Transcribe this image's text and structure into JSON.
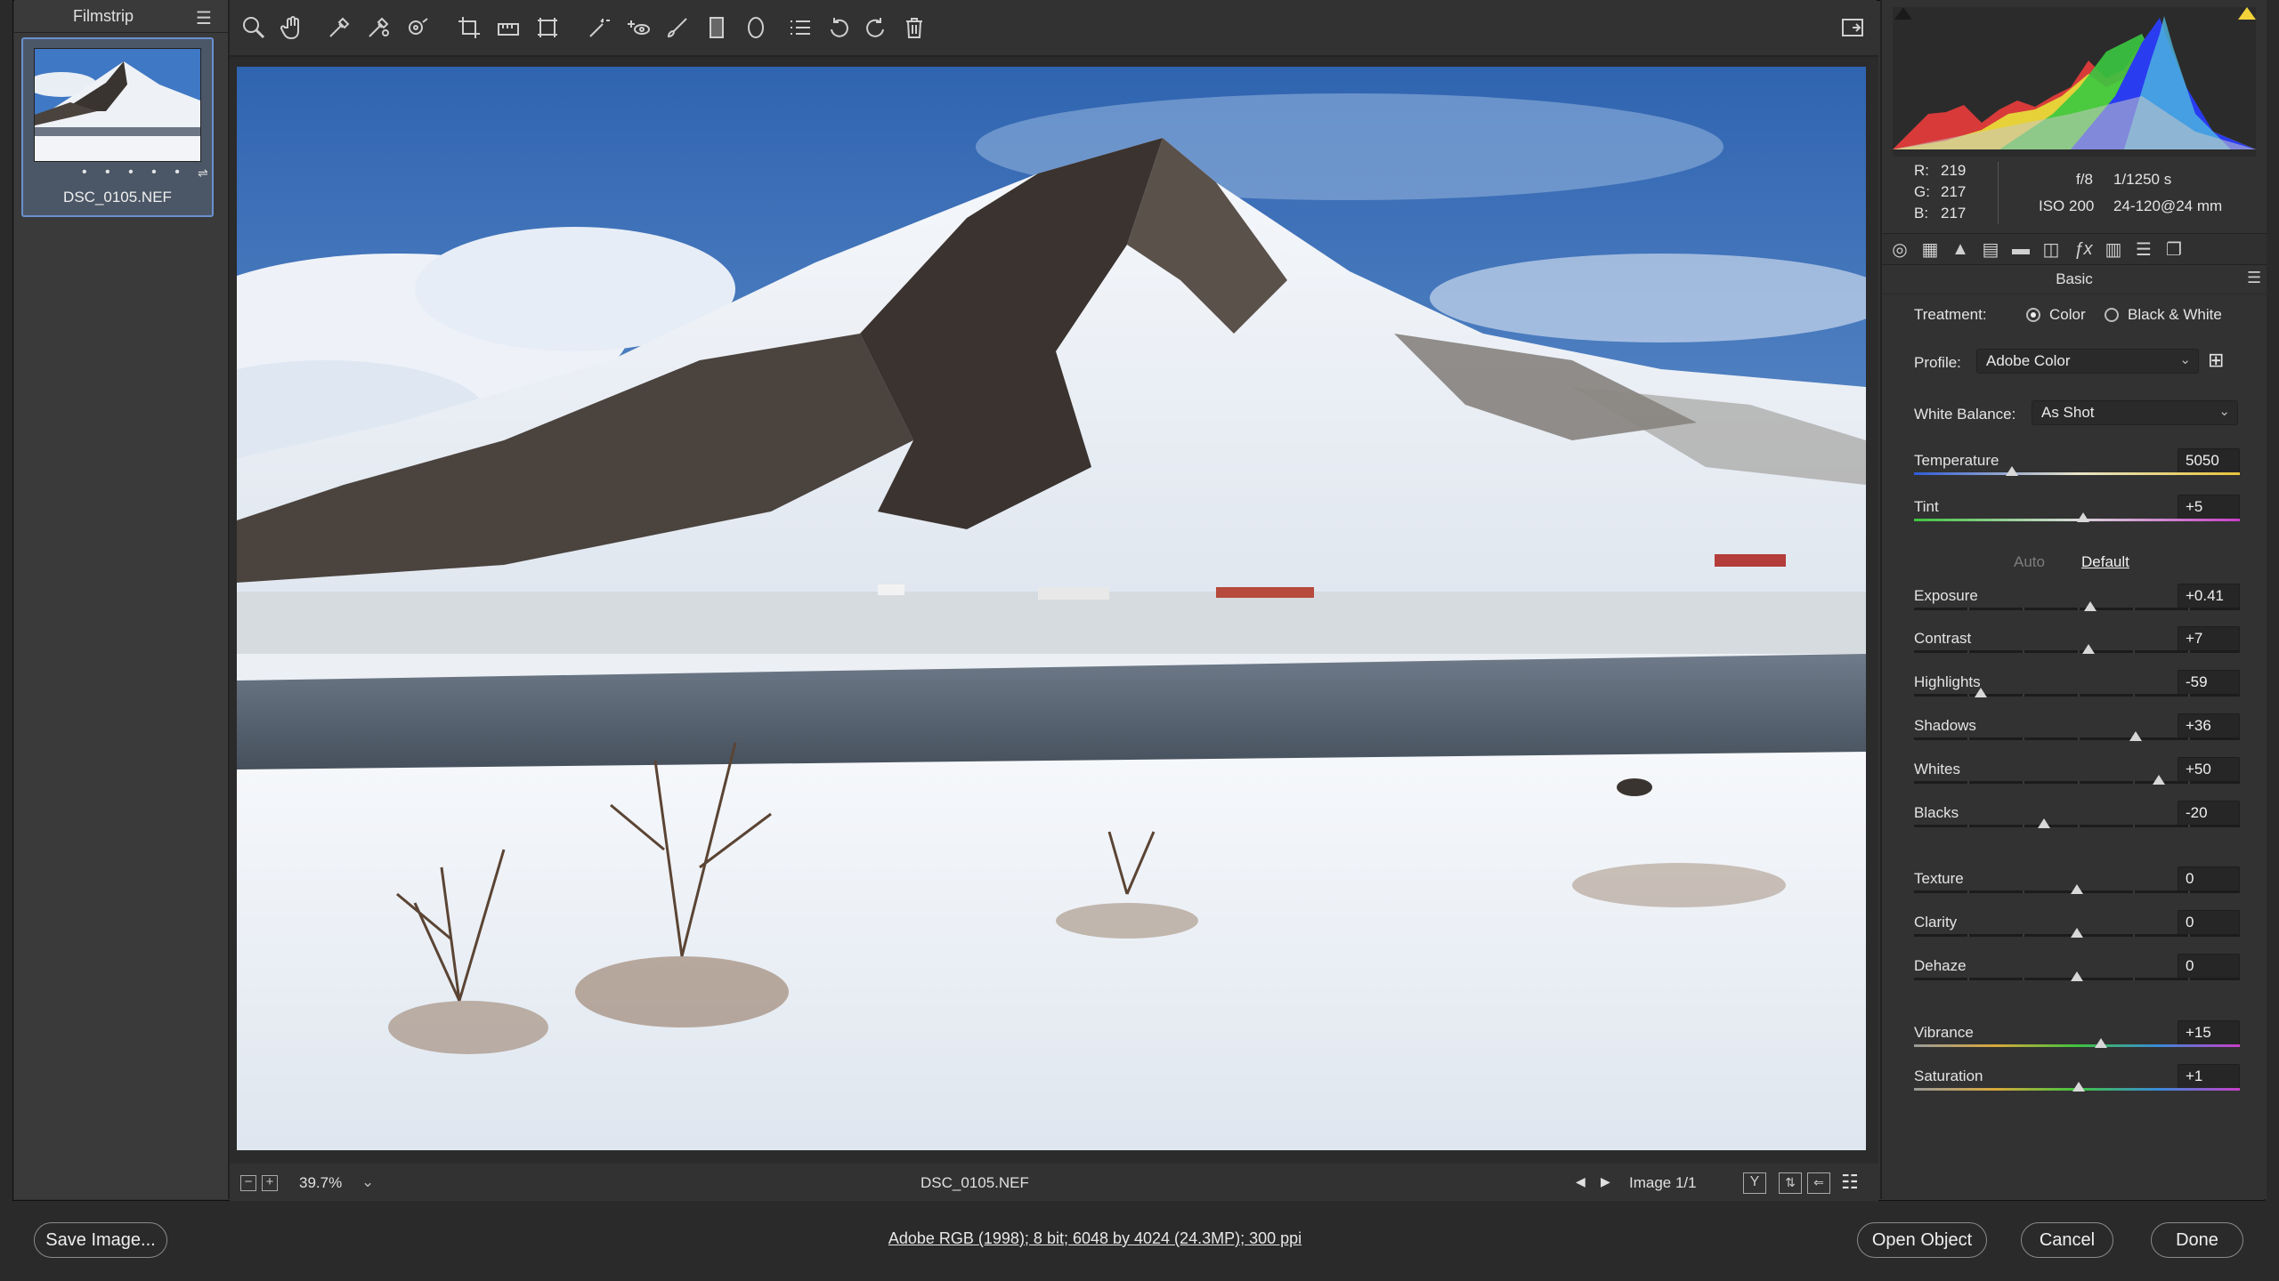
{
  "filmstrip": {
    "title": "Filmstrip",
    "thumbnail": {
      "name": "DSC_0105.NEF",
      "stars": "• • • • •"
    }
  },
  "toolbar": {
    "tools": [
      "zoom-tool-icon",
      "hand-tool-icon",
      "white-balance-tool-icon",
      "color-sampler-icon",
      "targeted-adjustment-icon",
      "crop-icon",
      "straighten-icon",
      "transform-icon",
      "spot-removal-icon",
      "red-eye-icon",
      "adjustment-brush-icon",
      "graduated-filter-icon",
      "radial-filter-icon",
      "presets-list-icon",
      "rotate-left-icon",
      "rotate-right-icon",
      "delete-icon"
    ]
  },
  "bottom_bar": {
    "zoom": "39.7%",
    "filename": "DSC_0105.NEF",
    "image_counter": "Image 1/1"
  },
  "readout": {
    "r_label": "R:",
    "r": "219",
    "g_label": "G:",
    "g": "217",
    "b_label": "B:",
    "b": "217",
    "aperture": "f/8",
    "shutter": "1/1250 s",
    "iso": "ISO 200",
    "lens": "24-120@24 mm"
  },
  "panel": {
    "title": "Basic",
    "treatment_label": "Treatment:",
    "treatment_color": "Color",
    "treatment_bw": "Black & White",
    "profile_label": "Profile:",
    "profile_value": "Adobe Color",
    "wb_label": "White Balance:",
    "wb_value": "As Shot",
    "auto_label": "Auto",
    "default_label": "Default",
    "sliders": [
      {
        "name": "Temperature",
        "value": "5050",
        "pos": 0.3
      },
      {
        "name": "Tint",
        "value": "+5",
        "pos": 0.52
      },
      {
        "name": "Exposure",
        "value": "+0.41",
        "pos": 0.54
      },
      {
        "name": "Contrast",
        "value": "+7",
        "pos": 0.535
      },
      {
        "name": "Highlights",
        "value": "-59",
        "pos": 0.205
      },
      {
        "name": "Shadows",
        "value": "+36",
        "pos": 0.68
      },
      {
        "name": "Whites",
        "value": "+50",
        "pos": 0.75
      },
      {
        "name": "Blacks",
        "value": "-20",
        "pos": 0.4
      },
      {
        "name": "Texture",
        "value": "0",
        "pos": 0.5
      },
      {
        "name": "Clarity",
        "value": "0",
        "pos": 0.5
      },
      {
        "name": "Dehaze",
        "value": "0",
        "pos": 0.5
      },
      {
        "name": "Vibrance",
        "value": "+15",
        "pos": 0.575
      },
      {
        "name": "Saturation",
        "value": "+1",
        "pos": 0.505
      }
    ]
  },
  "footer": {
    "save_label": "Save Image...",
    "info": "Adobe RGB (1998); 8 bit; 6048 by 4024 (24.3MP); 300 ppi",
    "open_label": "Open Object",
    "cancel_label": "Cancel",
    "done_label": "Done"
  }
}
